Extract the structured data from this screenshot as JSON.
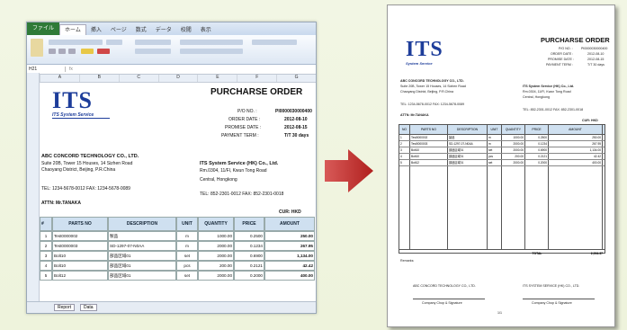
{
  "excel": {
    "file_tab": "ファイル",
    "tabs": [
      "ホーム",
      "挿入",
      "ページ",
      "数式",
      "データ",
      "校閲",
      "表示"
    ],
    "name_box": "H21",
    "columns": [
      "A",
      "B",
      "C",
      "D",
      "E",
      "F",
      "G"
    ],
    "company_title": "ITS",
    "company_sub": "ITS System Service",
    "po_title": "PURCHARSE ORDER",
    "po_no_label": "P/O NO. :",
    "po_no": "PI0000030000400",
    "order_date_label": "ORDER DATE :",
    "order_date": "2012-08-10",
    "promise_date_label": "PROMISE DATE :",
    "promise_date": "2012-08-15",
    "payment_label": "PAYMENT TERM :",
    "payment": "T/T 30 days",
    "vendor_name": "ABC CONCORD TECHNOLOGY CO., LTD.",
    "vendor_addr1": "Suite 20B, Tower 15 Houses, 14 Sizhen Road",
    "vendor_addr2": "Chaoyang District, Beijing, P.R.China",
    "vendor_tel": "TEL: 1234-5678-0012   FAX: 1234-5678-0089",
    "attn": "ATTN: Mr.TANAKA",
    "buyer_name": "ITS System Service (HK) Co., Ltd.",
    "buyer_addr1": "Rm.0304, 11/Fl, Kwun Tong Road",
    "buyer_addr2": "Central, Hongkong",
    "buyer_tel": "TEL: 852-2301-0012   FAX: 852-2301-0018",
    "currency": "CUR: HKD",
    "headers": [
      "#",
      "PARTS NO",
      "DESCRIPTION",
      "UNIT",
      "QUANTITY",
      "PRICE",
      "AMOUNT"
    ],
    "rows": [
      [
        "1",
        "Test0000002",
        "製品",
        "m",
        "1000.00",
        "0.2500",
        "250.00"
      ],
      [
        "2",
        "Test0000003",
        "SD-1297-07-N0AA",
        "m",
        "2000.00",
        "0.1234",
        "267.95"
      ],
      [
        "3",
        "Bolt10",
        "部品区域01",
        "set",
        "2000.00",
        "0.6900",
        "1,134.00"
      ],
      [
        "4",
        "Bolt10",
        "部品区域01",
        "pcs",
        "200.00",
        "0.2121",
        "42.42"
      ],
      [
        "5",
        "Bolt12",
        "部品区域01",
        "set",
        "2000.00",
        "0.2000",
        "400.00"
      ]
    ],
    "sheet_tabs": [
      "Report",
      "Data"
    ]
  },
  "page": {
    "logo": "ITS",
    "logo_sub": "System Service",
    "title": "PURCHARSE ORDER",
    "po_no_label": "P/O NO. :",
    "po_no": "PI0000030000400",
    "order_date_label": "ORDER DATE :",
    "order_date": "2012-08-10",
    "promise_date_label": "PROMISE DATE :",
    "promise_date": "2012-08-15",
    "payment_label": "PAYMENT TERM :",
    "payment": "T/T 30 days",
    "vendor_name": "ABC CONCORD TECHNOLOGY CO., LTD.",
    "vendor_addr1": "Suite 20B, Tower 15 Houses, 14 Sizhen Road",
    "vendor_addr2": "Chaoyang District, Beijing, P.R.China",
    "vendor_tel": "TEL: 1234-5678-0012   FAX: 1234-5678-0089",
    "attn": "ATTN: Mr.TANAKA",
    "buyer_name": "ITS System Service (HK) Co., Ltd.",
    "buyer_addr1": "Rm.0304, 11/Fl, Kwun Tong Road",
    "buyer_addr2": "Central, Hongkong",
    "buyer_tel": "TEL: 852-2301-0012   FAX: 852-2301-0018",
    "currency": "CUR: HKD",
    "headers": [
      "NO",
      "PARTS NO",
      "DESCRIPTION",
      "UNIT",
      "QUANTITY",
      "PRICE",
      "AMOUNT"
    ],
    "rows": [
      [
        "1",
        "Test0000002",
        "製品",
        "m",
        "1000.00",
        "0.2500",
        "250.00"
      ],
      [
        "2",
        "Test0000003",
        "SD-1297-07-N0AA",
        "m",
        "2000.00",
        "0.1234",
        "267.95"
      ],
      [
        "3",
        "Bolt10",
        "部品区域01",
        "set",
        "2000.00",
        "0.6900",
        "1,134.00"
      ],
      [
        "4",
        "Bolt10",
        "部品区域01",
        "pcs",
        "200.00",
        "0.2121",
        "42.42"
      ],
      [
        "5",
        "Bolt12",
        "部品区域01",
        "set",
        "2000.00",
        "0.2000",
        "400.00"
      ]
    ],
    "total_label": "TOTAL",
    "total": "2,094.37",
    "remarks_label": "Remarks:",
    "sign_left": "ABC CONCORD TECHNOLOGY CO., LTD.",
    "sign_right": "ITS SYSTEM SERVICE (HK) CO., LTD.",
    "sign_left_caption": "Company Chop & Signature",
    "sign_right_caption": "Company Chop & Signature",
    "page_no": "1/1"
  },
  "colors": {
    "logo_blue": "#1d3d9a",
    "arrow_red": "#c3302e",
    "header_blue": "#cfe0f0"
  }
}
